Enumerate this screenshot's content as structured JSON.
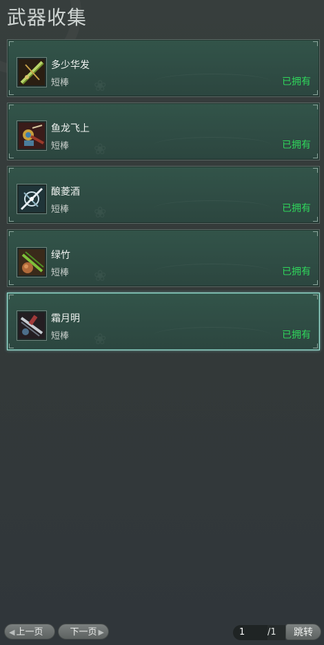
{
  "header": {
    "title": "武器收集"
  },
  "weapons": [
    {
      "name": "多少华发",
      "type": "短棒",
      "status": "已拥有",
      "icon": "green-staff-icon"
    },
    {
      "name": "鱼龙飞上",
      "type": "短棒",
      "status": "已拥有",
      "icon": "dragon-staff-icon"
    },
    {
      "name": "酿菱酒",
      "type": "短棒",
      "status": "已拥有",
      "icon": "silver-wine-staff-icon"
    },
    {
      "name": "绿竹",
      "type": "短棒",
      "status": "已拥有",
      "icon": "bamboo-gourd-icon"
    },
    {
      "name": "霜月明",
      "type": "短棒",
      "status": "已拥有",
      "icon": "frost-moon-staff-icon",
      "selected": true
    }
  ],
  "pager": {
    "prev_label": "上一页",
    "next_label": "下一页",
    "current_page": "1",
    "total_pages": "/1",
    "jump_label": "跳转"
  },
  "colors": {
    "owned": "#2fd65b",
    "card_bg": "#2f4c44",
    "selected_border": "#9fe0d4"
  }
}
